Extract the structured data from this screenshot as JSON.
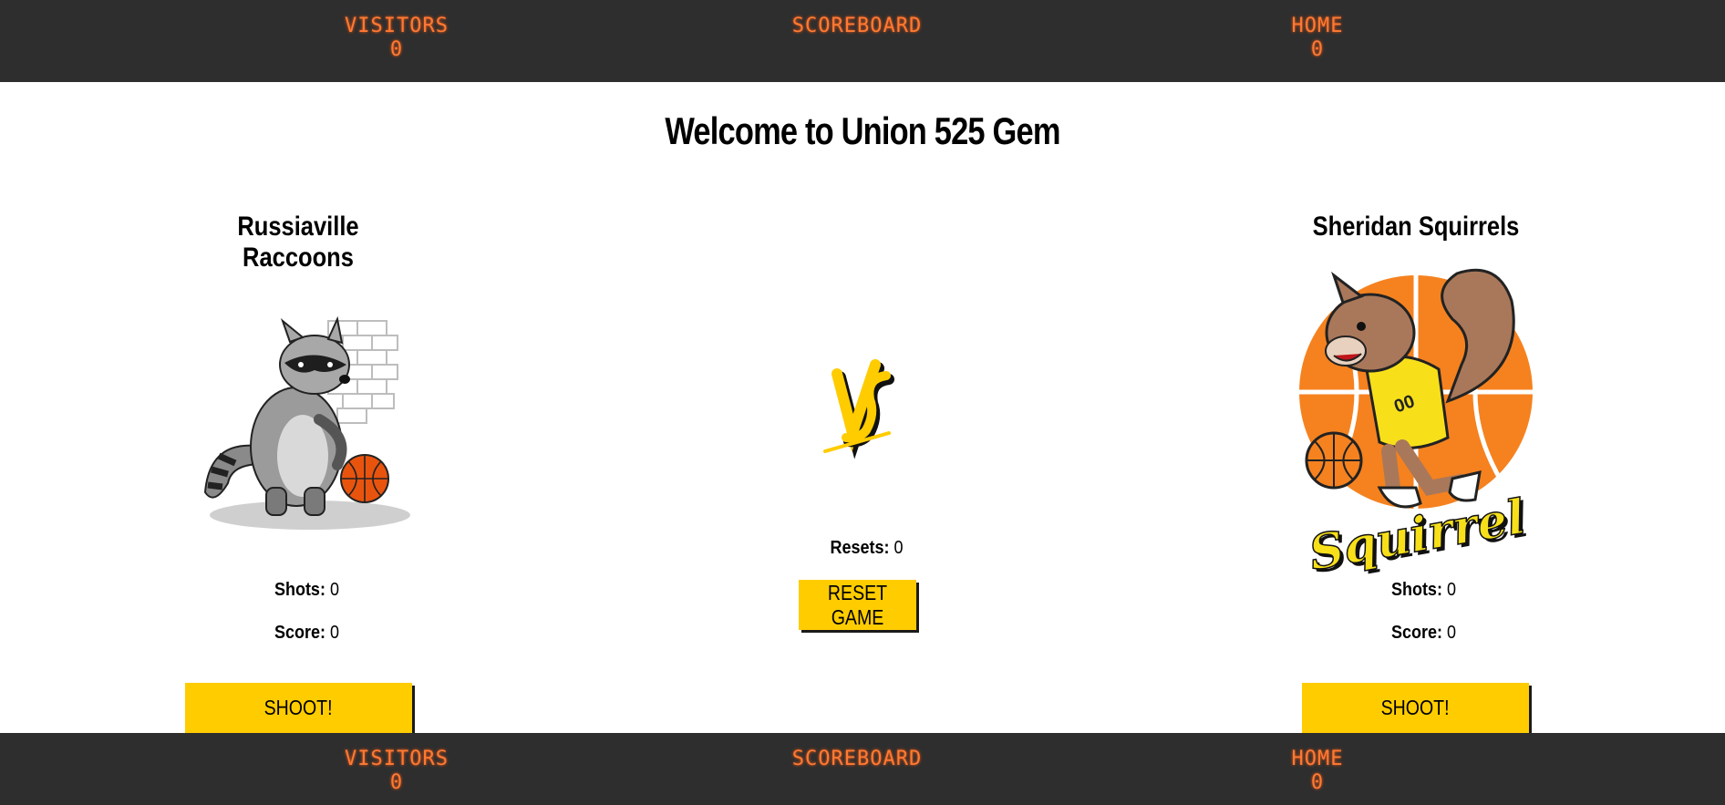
{
  "scoreboard_top": {
    "visitors_label": "VISITORS",
    "visitors_score": "0",
    "center_label": "SCOREBOARD",
    "home_label": "HOME",
    "home_score": "0"
  },
  "scoreboard_bottom": {
    "visitors_label": "VISITORS",
    "visitors_score": "0",
    "center_label": "SCOREBOARD",
    "home_label": "HOME",
    "home_score": "0"
  },
  "title": "Welcome to Union 525 Gem",
  "visitors_team": {
    "name": "Russiaville Raccoons",
    "shots_label": "Shots:",
    "shots": "0",
    "score_label": "Score:",
    "score": "0",
    "shoot_label": "SHOOT!",
    "mascot_icon": "raccoon-icon"
  },
  "home_team": {
    "name": "Sheridan Squirrels",
    "shots_label": "Shots:",
    "shots": "0",
    "score_label": "Score:",
    "score": "0",
    "shoot_label": "SHOOT!",
    "mascot_icon": "squirrel-icon",
    "logo_text": "Squirrel"
  },
  "center": {
    "vs_icon": "vs-icon",
    "resets_label": "Resets:",
    "resets": "0",
    "reset_label": "RESET GAME"
  },
  "colors": {
    "scoreboard_bg": "#2e2e2e",
    "scoreboard_text": "#ff7a33",
    "button": "#ffcc00"
  }
}
